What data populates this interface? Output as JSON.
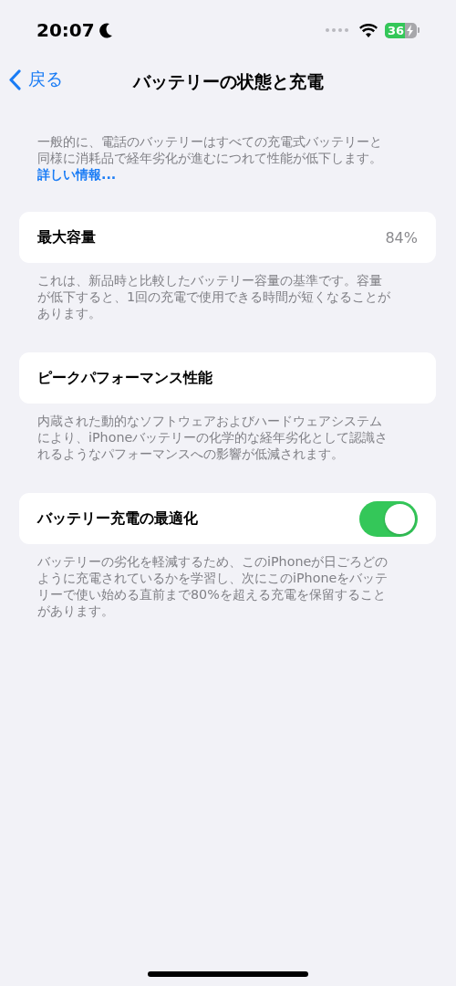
{
  "status_bar": {
    "time": "20:07",
    "battery": "36"
  },
  "nav": {
    "back": "戻る",
    "title": "バッテリーの状態と充電"
  },
  "intro": {
    "text": "一般的に、電話のバッテリーはすべての充電式バッテリーと同様に消耗品で経年劣化が進むにつれて性能が低下します。",
    "link": "詳しい情報..."
  },
  "sections": [
    {
      "kind": "value",
      "label": "最大容量",
      "value": "84%",
      "footer": "これは、新品時と比較したバッテリー容量の基準です。容量が低下すると、1回の充電で使用できる時間が短くなることがあります。"
    },
    {
      "kind": "plain",
      "label": "ピークパフォーマンス性能",
      "footer": "内蔵された動的なソフトウェアおよびハードウェアシステムにより、iPhoneバッテリーの化学的な経年劣化として認識されるようなパフォーマンスへの影響が低減されます。"
    },
    {
      "kind": "toggle",
      "label": "バッテリー充電の最適化",
      "on": true,
      "footer": "バッテリーの劣化を軽減するため、このiPhoneが日ごろどのように充電されているかを学習し、次にこのiPhoneをバッテリーで使い始める直前まで80%を超える充電を保留することがあります。"
    }
  ]
}
